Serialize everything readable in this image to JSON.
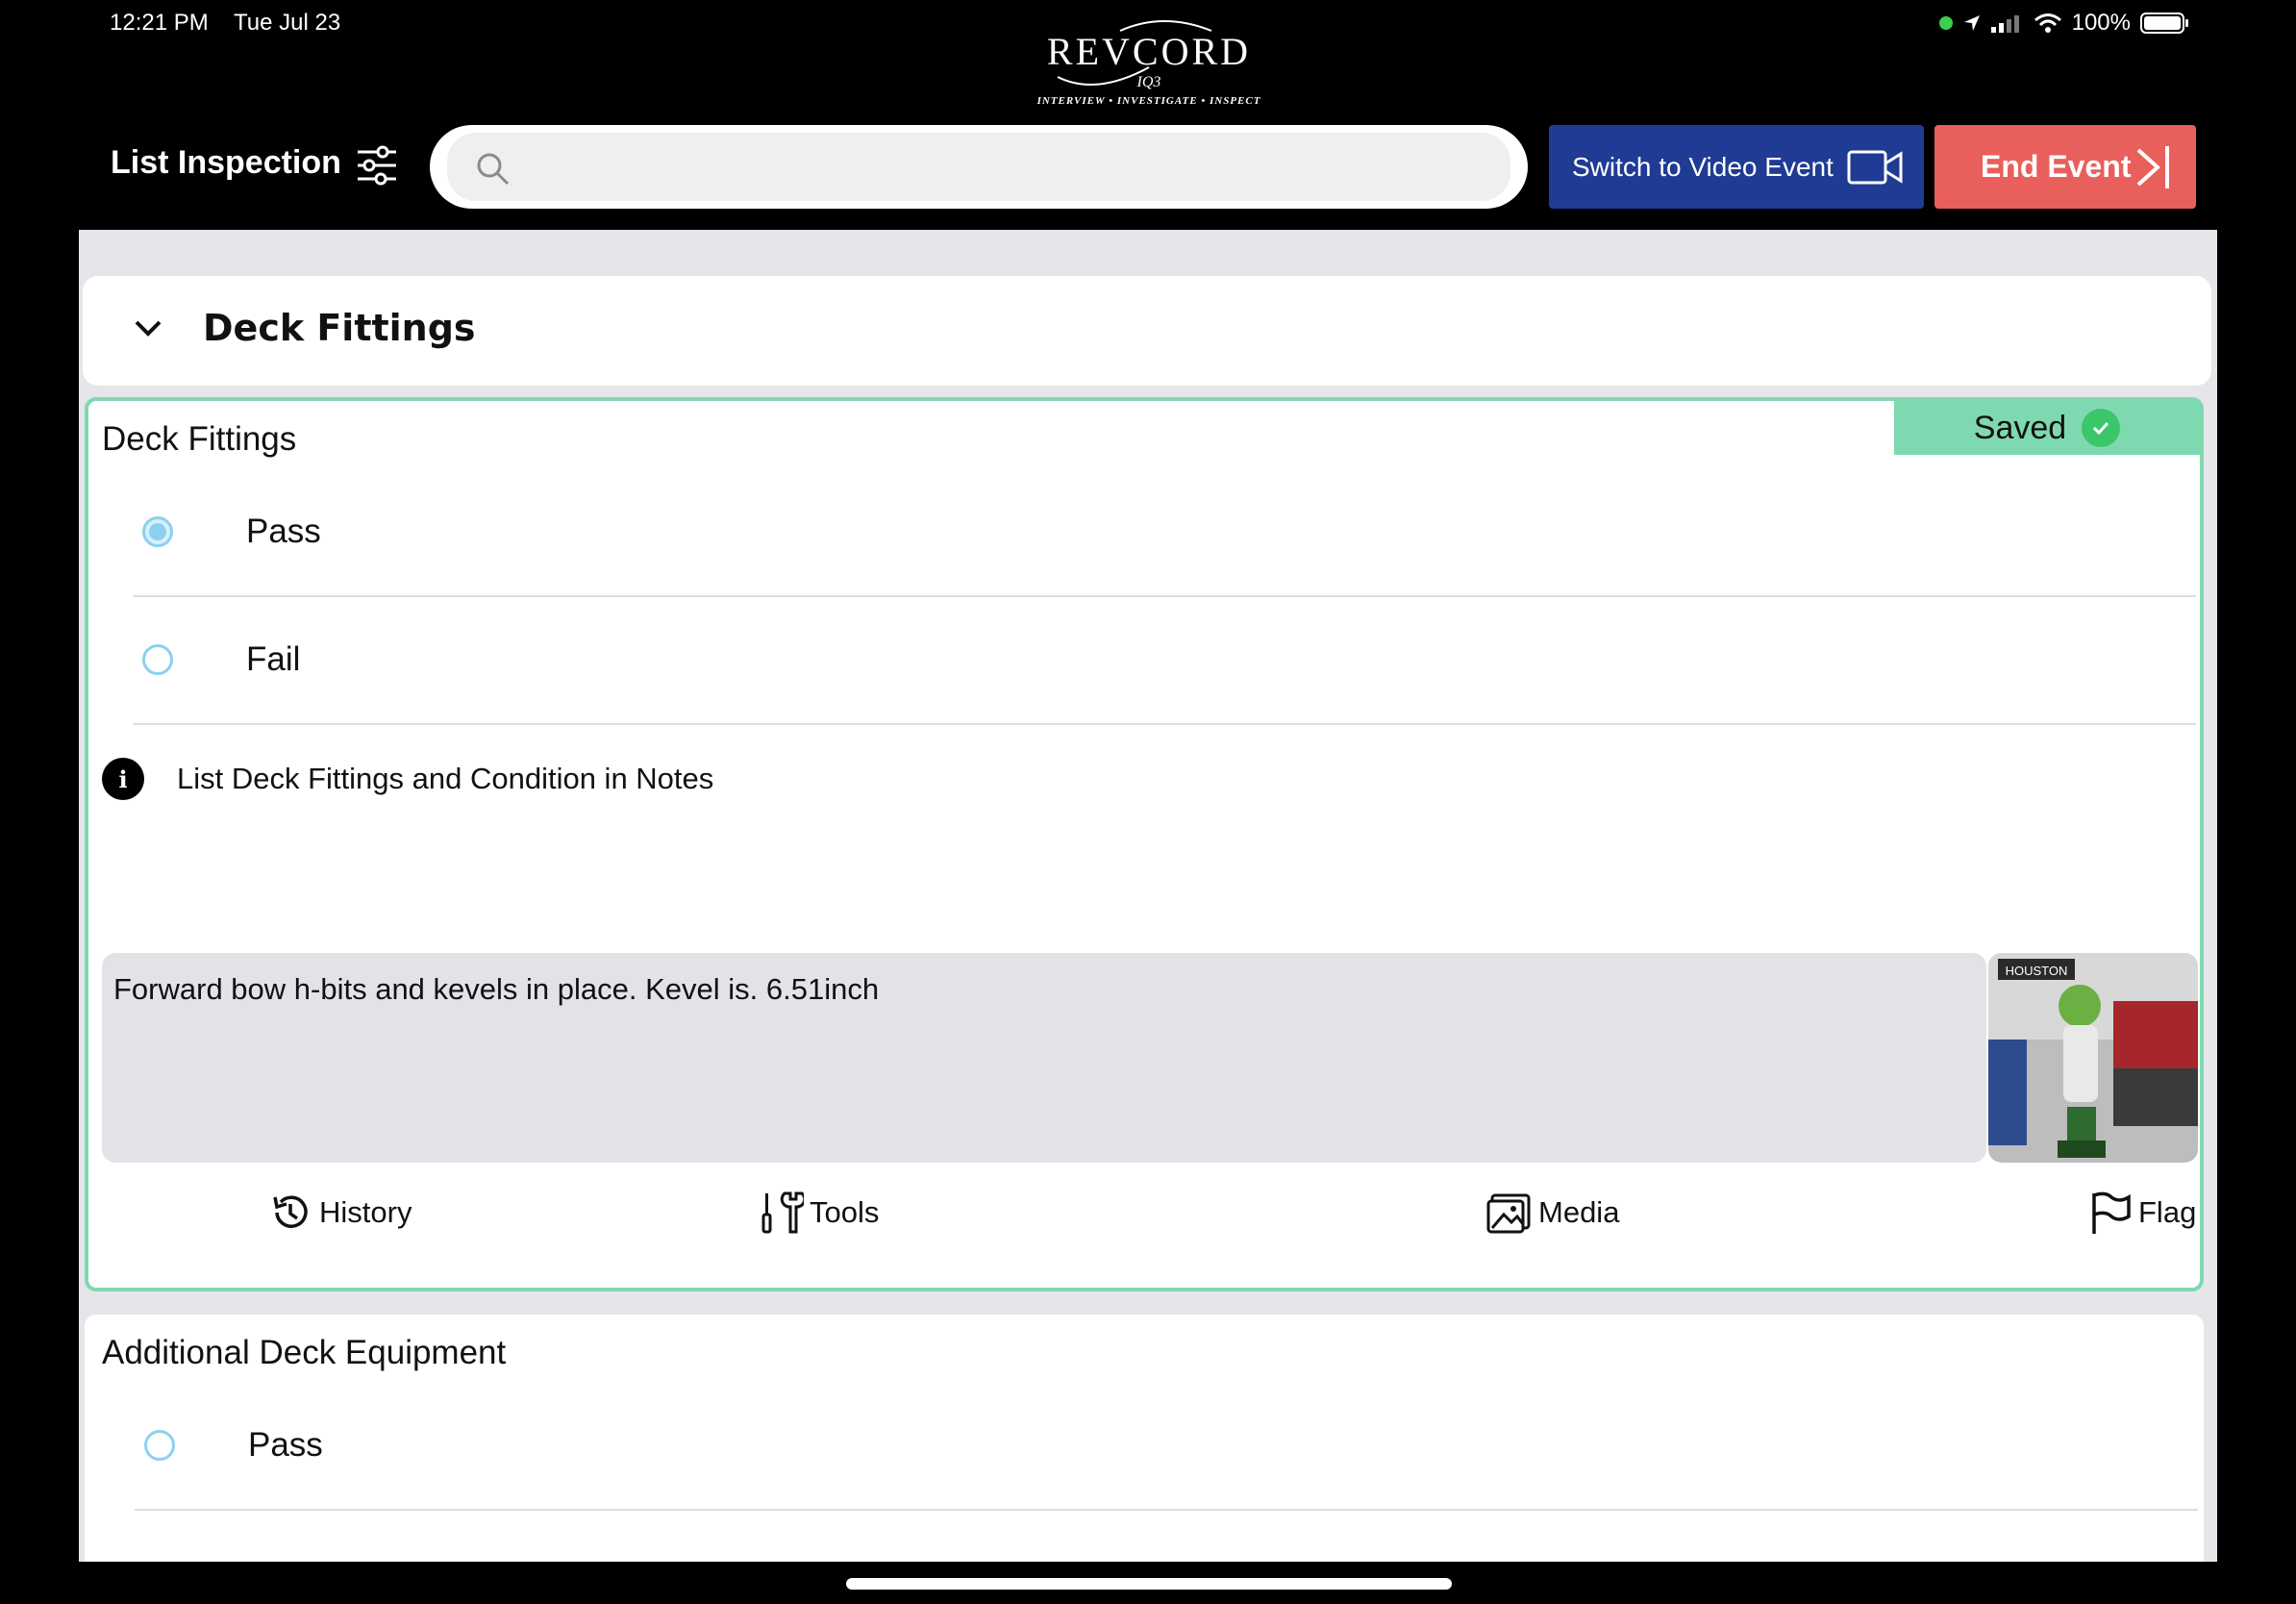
{
  "status_bar": {
    "time": "12:21 PM",
    "date": "Tue Jul 23",
    "battery": "100%"
  },
  "logo": {
    "word": "REVCORD",
    "sub": "IQ3",
    "tagline": "INTERVIEW • INVESTIGATE • INSPECT"
  },
  "header": {
    "title": "List Inspection",
    "search_placeholder": "",
    "video_button": "Switch to Video Event",
    "end_button": "End Event"
  },
  "section": {
    "title": "Deck Fittings"
  },
  "card": {
    "title": "Deck Fittings",
    "saved_label": "Saved",
    "options": [
      {
        "label": "Pass",
        "checked": true
      },
      {
        "label": "Fail",
        "checked": false
      }
    ],
    "info_text": "List Deck Fittings and Condition in Notes",
    "notes": "Forward bow h-bits and kevels in place. Kevel is. 6.51inch",
    "thumbnail_caption": "HOUSTON",
    "toolbar": {
      "history": "History",
      "tools": "Tools",
      "media": "Media",
      "flag": "Flag"
    }
  },
  "card2": {
    "title": "Additional Deck Equipment",
    "options": [
      {
        "label": "Pass",
        "checked": false
      }
    ]
  },
  "colors": {
    "accent_green": "#7fd9b0",
    "video_blue": "#1f3b94",
    "end_red": "#e95f5b",
    "radio_blue": "#8bd1f0"
  }
}
